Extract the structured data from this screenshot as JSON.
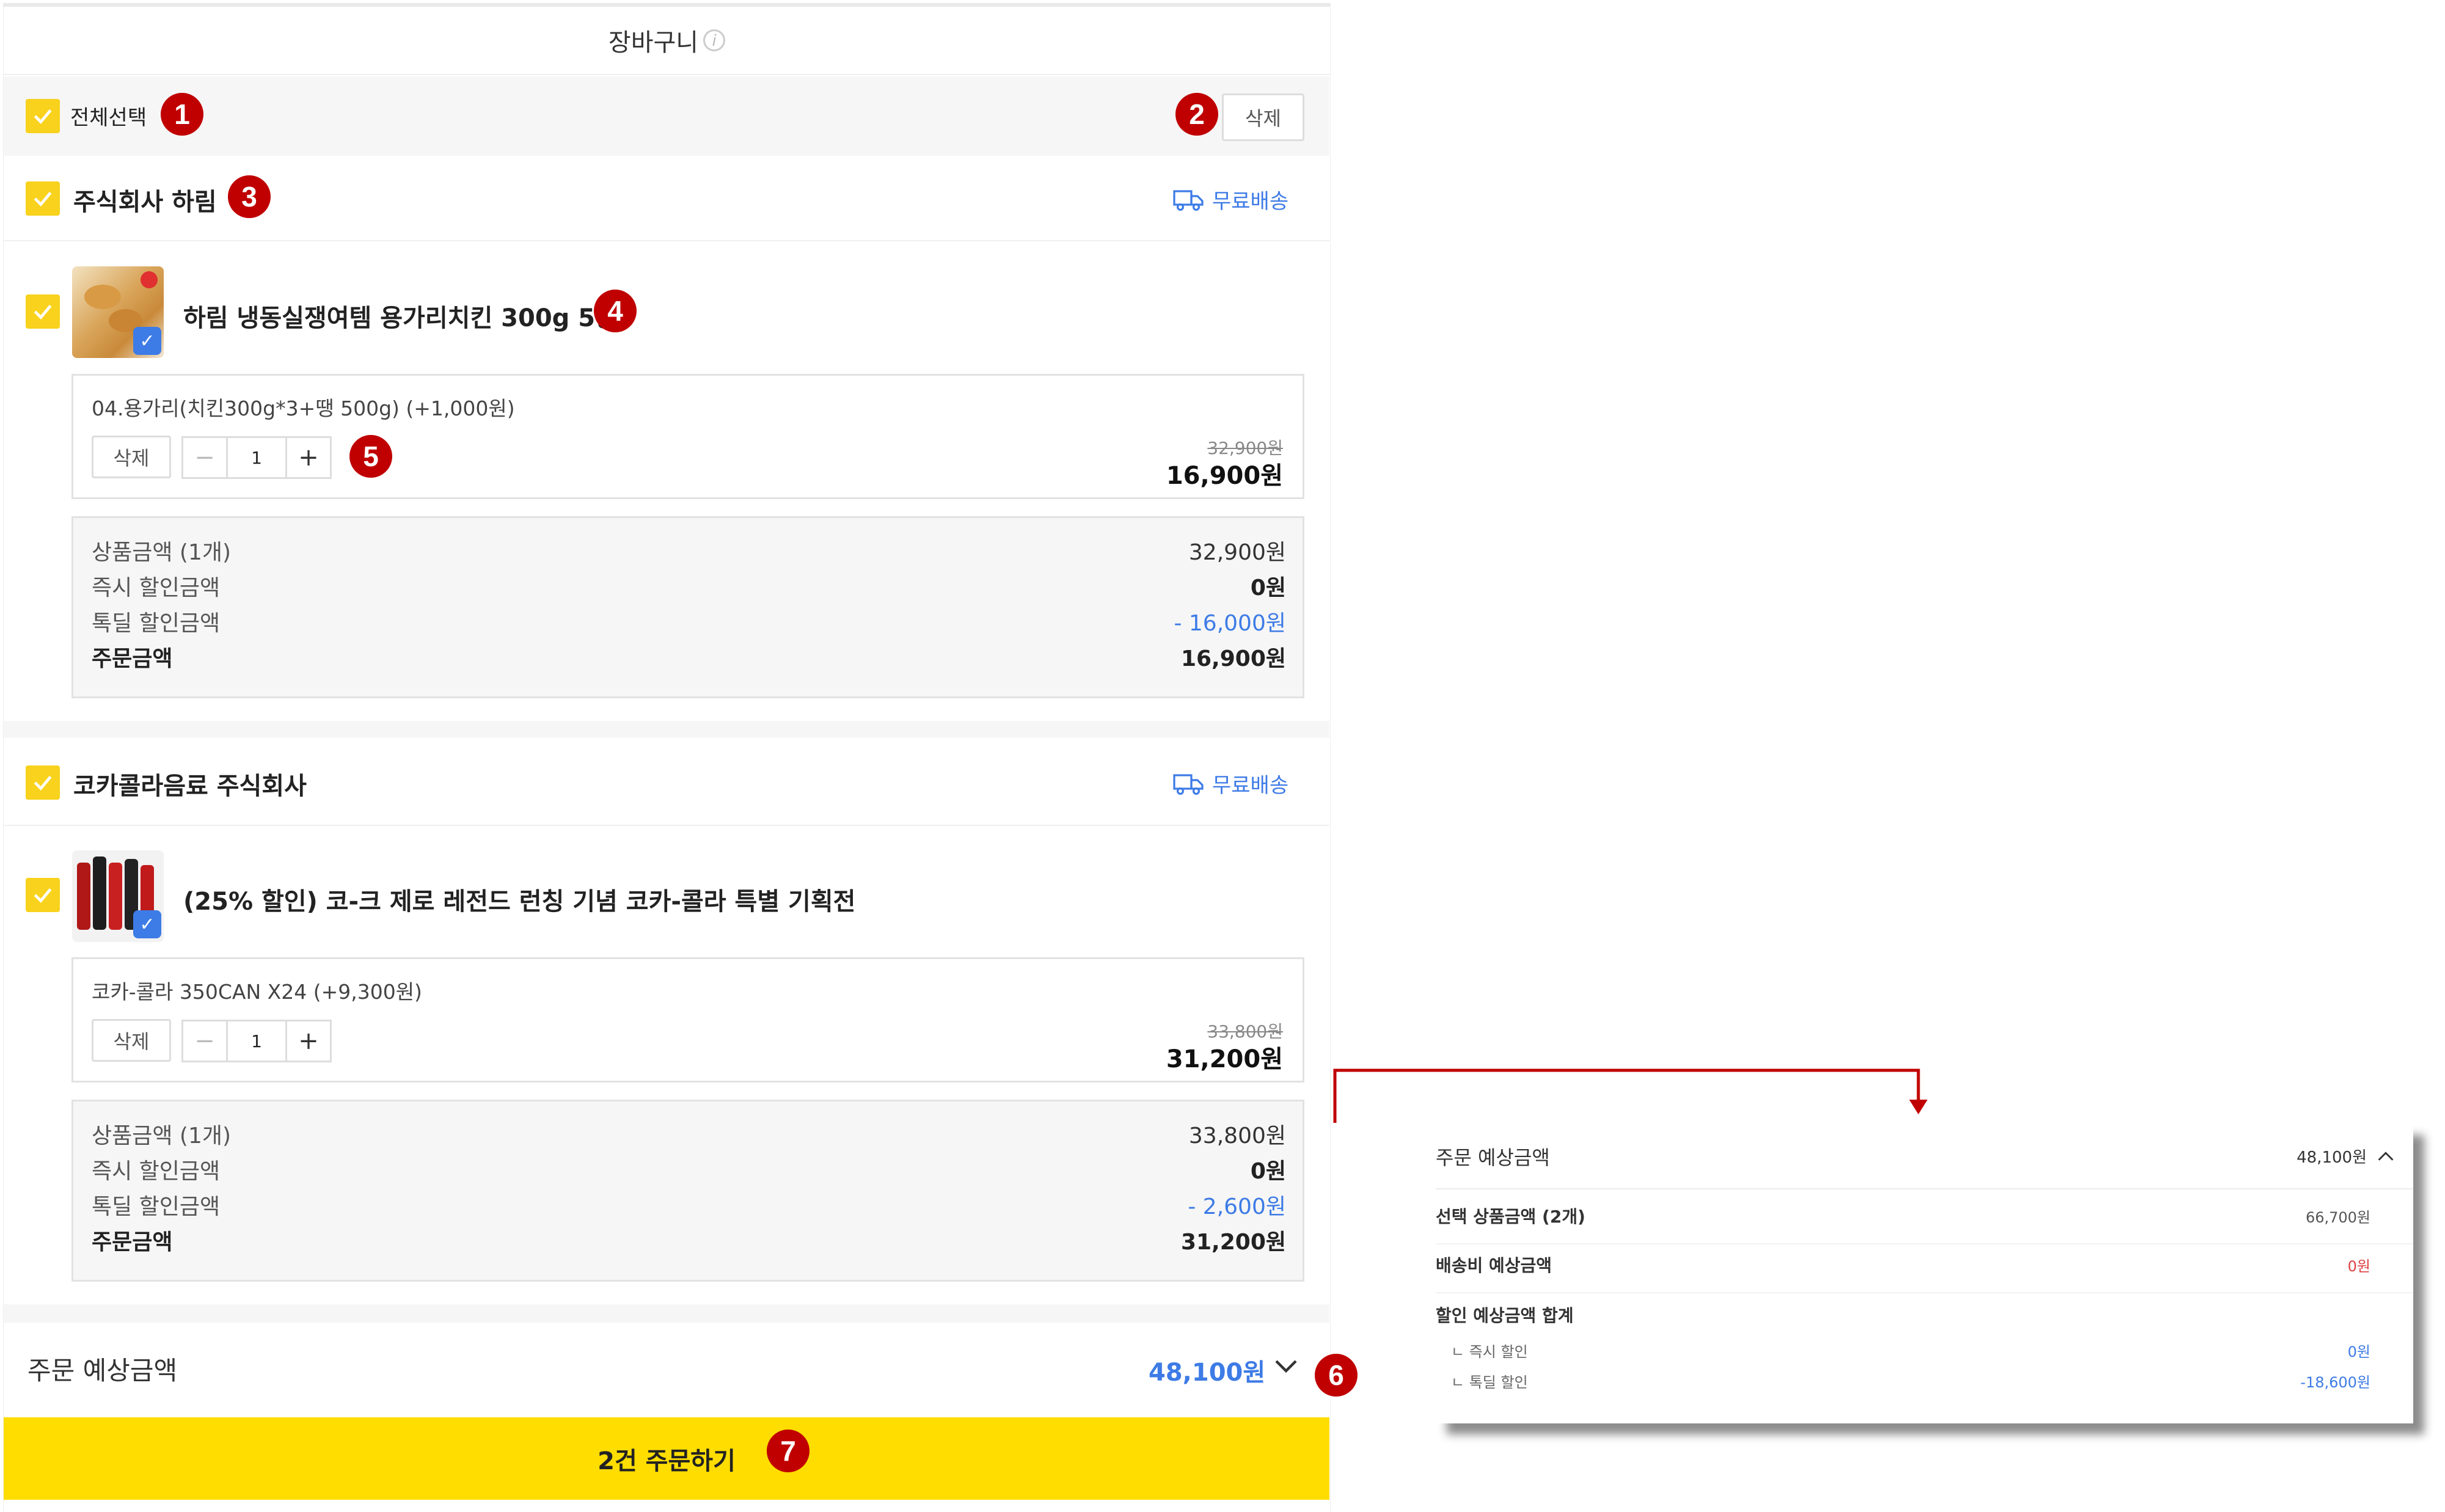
{
  "header": {
    "title": "장바구니",
    "info_icon": "info-icon"
  },
  "select_bar": {
    "select_all_label": "전체선택",
    "delete_label": "삭제"
  },
  "annotations": [
    "1",
    "2",
    "3",
    "4",
    "5",
    "6",
    "7"
  ],
  "sellers": [
    {
      "name": "주식회사 하림",
      "shipping": "무료배송",
      "product": {
        "name": "하림 냉동실쟁여템 용가리치킨 300g 5봉",
        "option": "04.용가리(치킨300g*3+땡 500g) (+1,000원)",
        "delete_label": "삭제",
        "qty": "1",
        "minus": "−",
        "plus": "+",
        "original_price": "32,900원",
        "price": "16,900원"
      },
      "summary": [
        {
          "label": "상품금액 (1개)",
          "value": "32,900원"
        },
        {
          "label": "즉시 할인금액",
          "value": "0원"
        },
        {
          "label": "톡딜 할인금액",
          "value": "- 16,000원"
        },
        {
          "label": "주문금액",
          "value": "16,900원"
        }
      ]
    },
    {
      "name": "코카콜라음료 주식회사",
      "shipping": "무료배송",
      "product": {
        "name": "(25% 할인) 코-크 제로 레전드 런칭 기념 코카-콜라 특별 기획전",
        "option": "코카-콜라 350CAN X24 (+9,300원)",
        "delete_label": "삭제",
        "qty": "1",
        "minus": "−",
        "plus": "+",
        "original_price": "33,800원",
        "price": "31,200원"
      },
      "summary": [
        {
          "label": "상품금액 (1개)",
          "value": "33,800원"
        },
        {
          "label": "즉시 할인금액",
          "value": "0원"
        },
        {
          "label": "톡딜 할인금액",
          "value": "- 2,600원"
        },
        {
          "label": "주문금액",
          "value": "31,200원"
        }
      ]
    }
  ],
  "estimate": {
    "label": "주문 예상금액",
    "value": "48,100원"
  },
  "order_button": "2건 주문하기",
  "popup": {
    "title": "주문 예상금액",
    "total": "48,100원",
    "rows": [
      {
        "label": "선택 상품금액 (2개)",
        "value": "66,700원"
      },
      {
        "label": "배송비 예상금액",
        "value": "0원"
      },
      {
        "label": "할인 예상금액 합계",
        "value": ""
      },
      {
        "label": "ㄴ 즉시 할인",
        "value": "0원"
      },
      {
        "label": "ㄴ 톡딜 할인",
        "value": "-18,600원"
      }
    ]
  },
  "colors": {
    "accent_yellow": "#ffdd00",
    "check_yellow": "#f8d21c",
    "link_blue": "#3d7be6",
    "annotation_red": "#c00000"
  }
}
